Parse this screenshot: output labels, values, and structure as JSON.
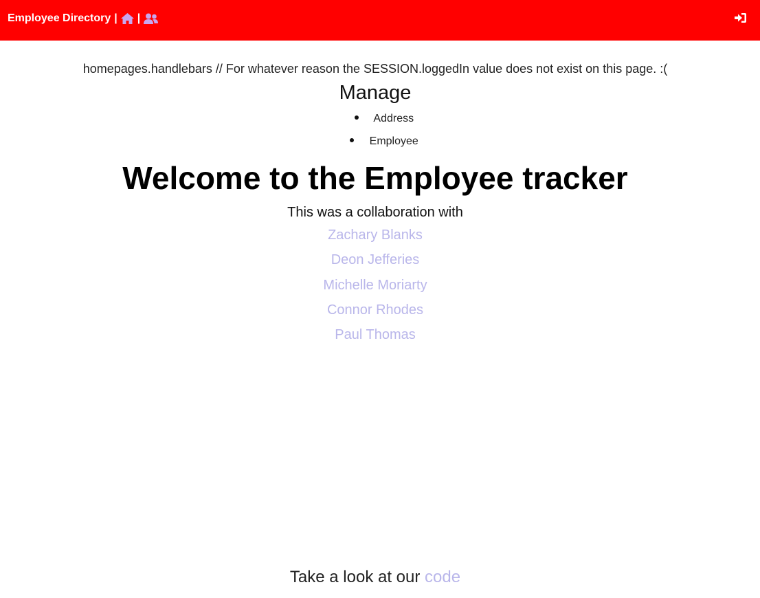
{
  "navbar": {
    "brand": "Employee Directory",
    "separator": "|",
    "icons": {
      "home": "home-icon",
      "employees": "users-icon",
      "login": "sign-in-icon"
    },
    "colors": {
      "background": "#ff0000",
      "icon_accent": "#c9a6f0"
    }
  },
  "note": "homepages.handlebars // For whatever reason the SESSION.loggedIn value does not exist on this page. :(",
  "manage": {
    "title": "Manage",
    "items": [
      {
        "label": "Address"
      },
      {
        "label": "Employee"
      }
    ]
  },
  "headline": "Welcome to the Employee tracker",
  "collaboration": {
    "intro": "This was a collaboration with",
    "people": [
      {
        "name": "Zachary Blanks"
      },
      {
        "name": "Deon Jefferies"
      },
      {
        "name": "Michelle Moriarty"
      },
      {
        "name": "Connor Rhodes"
      },
      {
        "name": "Paul Thomas"
      }
    ],
    "link_color": "#b9b6ea"
  },
  "footer": {
    "text": "Take a look at our",
    "link_label": "code"
  }
}
